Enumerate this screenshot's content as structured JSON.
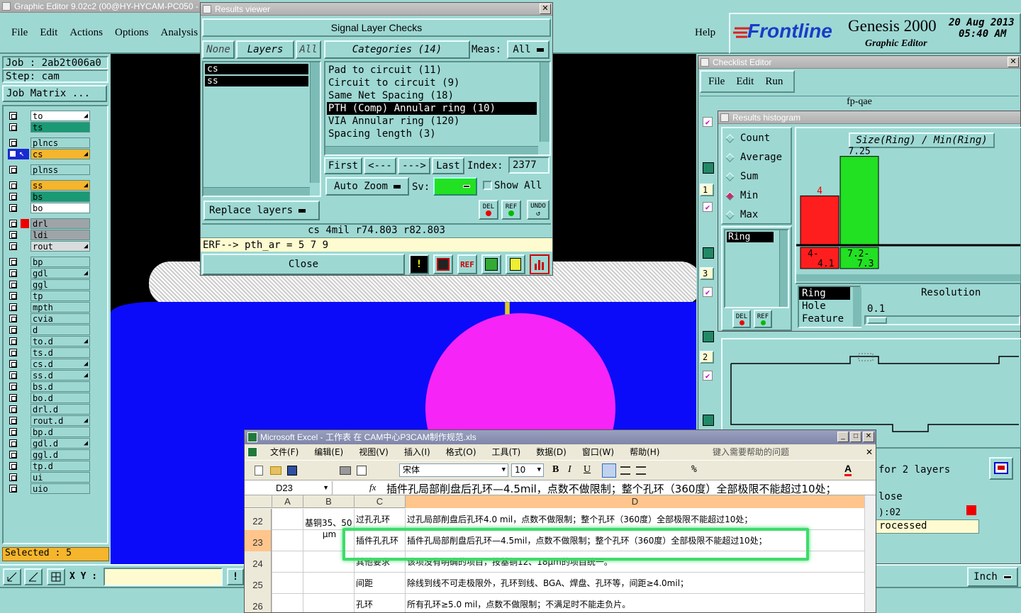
{
  "graphic_editor": {
    "title": "Graphic Editor 9.02c2 (00@HY-HYCAM-PC050 -",
    "menu": [
      "File",
      "Edit",
      "Actions",
      "Options",
      "Analysis"
    ],
    "help": "Help",
    "job": "Job : 2ab2t006a0",
    "step": "Step: cam",
    "job_matrix": "Job Matrix ...",
    "selected": "Selected : 5",
    "xy_label": "X Y :",
    "units": "Inch",
    "layers": [
      {
        "name": "to",
        "color": "#ffffff",
        "arrow": true
      },
      {
        "name": "ts",
        "color": "#1a9a74",
        "arrow": false
      },
      {
        "name": "plncs",
        "color": "#9ed8d3",
        "arrow": false
      },
      {
        "name": "cs",
        "color": "#f5b52c",
        "arrow": true
      },
      {
        "name": "plnss",
        "color": "#9ed8d3",
        "arrow": false
      },
      {
        "name": "ss",
        "color": "#f5b52c",
        "arrow": true
      },
      {
        "name": "bs",
        "color": "#1a9a74",
        "arrow": false
      },
      {
        "name": "bo",
        "color": "#ffffff",
        "arrow": false
      },
      {
        "name": "drl",
        "color": "#9ea4a8",
        "arrow": false
      },
      {
        "name": "ldi",
        "color": "#9ea4a8",
        "arrow": false
      },
      {
        "name": "rout",
        "color": "#d8dcdc",
        "arrow": true
      },
      {
        "name": "bp",
        "color": "#9ed8d3",
        "arrow": false
      },
      {
        "name": "gdl",
        "color": "#9ed8d3",
        "arrow": true
      },
      {
        "name": "ggl",
        "color": "#9ed8d3",
        "arrow": false
      },
      {
        "name": "tp",
        "color": "#9ed8d3",
        "arrow": false
      },
      {
        "name": "mpth",
        "color": "#9ed8d3",
        "arrow": false
      },
      {
        "name": "cvia",
        "color": "#9ed8d3",
        "arrow": false
      },
      {
        "name": "d",
        "color": "#9ed8d3",
        "arrow": false
      },
      {
        "name": "to.d",
        "color": "#9ed8d3",
        "arrow": true
      },
      {
        "name": "ts.d",
        "color": "#9ed8d3",
        "arrow": false
      },
      {
        "name": "cs.d",
        "color": "#9ed8d3",
        "arrow": true
      },
      {
        "name": "ss.d",
        "color": "#9ed8d3",
        "arrow": true
      },
      {
        "name": "bs.d",
        "color": "#9ed8d3",
        "arrow": false
      },
      {
        "name": "bo.d",
        "color": "#9ed8d3",
        "arrow": false
      },
      {
        "name": "drl.d",
        "color": "#9ed8d3",
        "arrow": false
      },
      {
        "name": "rout.d",
        "color": "#9ed8d3",
        "arrow": true
      },
      {
        "name": "bp.d",
        "color": "#9ed8d3",
        "arrow": false
      },
      {
        "name": "gdl.d",
        "color": "#9ed8d3",
        "arrow": true
      },
      {
        "name": "ggl.d",
        "color": "#9ed8d3",
        "arrow": false
      },
      {
        "name": "tp.d",
        "color": "#9ed8d3",
        "arrow": false
      },
      {
        "name": "ui",
        "color": "#9ed8d3",
        "arrow": false
      },
      {
        "name": "uio",
        "color": "#9ed8d3",
        "arrow": false
      }
    ]
  },
  "brand": {
    "logo": "Frontline",
    "product": "Genesis 2000",
    "sub": "Graphic Editor",
    "date": "20 Aug 2013",
    "time": "05:40 AM"
  },
  "results_viewer": {
    "title": "Results viewer",
    "header": "Signal Layer Checks",
    "none": "None",
    "layers_btn": "Layers",
    "all": "All",
    "categories": "Categories (14)",
    "meas_label": "Meas:",
    "meas_value": "All",
    "layer_list": [
      "cs",
      "ss"
    ],
    "category_items": [
      "Pad to circuit (11)",
      "Circuit to circuit (9)",
      "Same Net Spacing (18)",
      "PTH (Comp) Annular ring (10)",
      "VIA Annular ring (120)",
      "Spacing length (3)"
    ],
    "selected_category": 3,
    "first": "First",
    "prev": "<---",
    "next": "--->",
    "last": "Last",
    "index_label": "Index:",
    "index_value": "2377",
    "auto_zoom": "Auto Zoom",
    "sv_label": "Sv:",
    "show_all": "Show All",
    "replace_layers": "Replace layers",
    "del": "DEL",
    "ref": "REF",
    "undo": "UNDO",
    "status": "cs 4mil  r74.803  r82.803",
    "erf": "ERF--> pth_ar = 5 7 9",
    "close": "Close"
  },
  "checklist": {
    "title": "Checklist Editor",
    "menu": [
      "File",
      "Edit",
      "Run"
    ],
    "name": "fp-qae",
    "side_numbers": [
      "1",
      "3",
      "2"
    ],
    "for_layers": "for 2 layers",
    "close_partial": "lose",
    "processed": "rocessed",
    "time_partial": "):02"
  },
  "histogram": {
    "title": "Results histogram",
    "options": [
      "Count",
      "Average",
      "Sum",
      "Min",
      "Max"
    ],
    "selected_option": "Min",
    "chart_title": "Size(Ring) / Min(Ring)",
    "list": [
      "Ring"
    ],
    "del": "DEL",
    "ref": "REF",
    "resolution_label": "Resolution",
    "resolution_value": "0.1",
    "field_list": [
      "Ring",
      "Hole",
      "Feature"
    ],
    "chart_data": {
      "type": "bar",
      "categories": [
        "4-4.1",
        "7.2-7.3"
      ],
      "values": [
        4,
        7.25
      ],
      "colors": [
        "#ff1e1e",
        "#22e022"
      ],
      "labels": [
        "4",
        "7.25"
      ]
    }
  },
  "excel": {
    "title": "Microsoft Excel - 工作表 在 CAM中心P3CAM制作规范.xls",
    "menu": [
      "文件(F)",
      "编辑(E)",
      "视图(V)",
      "插入(I)",
      "格式(O)",
      "工具(T)",
      "数据(D)",
      "窗口(W)",
      "帮助(H)"
    ],
    "help_placeholder": "键入需要帮助的问题",
    "font": "宋体",
    "size": "10",
    "cell_ref": "D23",
    "formula": "插件孔局部削盘后孔环—4.5mil，点数不做限制；整个孔环（360度）全部极限不能超过10处；",
    "columns": [
      "A",
      "B",
      "C",
      "D"
    ],
    "rows": [
      {
        "n": "22",
        "b": "基铜35、50",
        "c": "过孔孔环",
        "d": "过孔局部削盘后孔环4.0 mil，点数不做限制；整个孔环（360度）全部极限不能超过10处；"
      },
      {
        "n": "23",
        "b": "μm",
        "c": "插件孔孔环",
        "d": "插件孔局部削盘后孔环—4.5mil，点数不做限制；整个孔环（360度）全部极限不能超过10处；"
      },
      {
        "n": "24",
        "b": "",
        "c": "其他要求",
        "d": "该项没有明确的项目，按基铜12、18μm的项目统一。"
      },
      {
        "n": "25",
        "b": "",
        "c": "间距",
        "d": "除线到线不可走极限外，孔环到线、BGA、焊盘、孔环等，间距≥4.0mil；"
      },
      {
        "n": "26",
        "b": "",
        "c": "孔环",
        "d": "所有孔环≥5.0 mil，点数不做限制；不满足时不能走负片。"
      }
    ]
  }
}
